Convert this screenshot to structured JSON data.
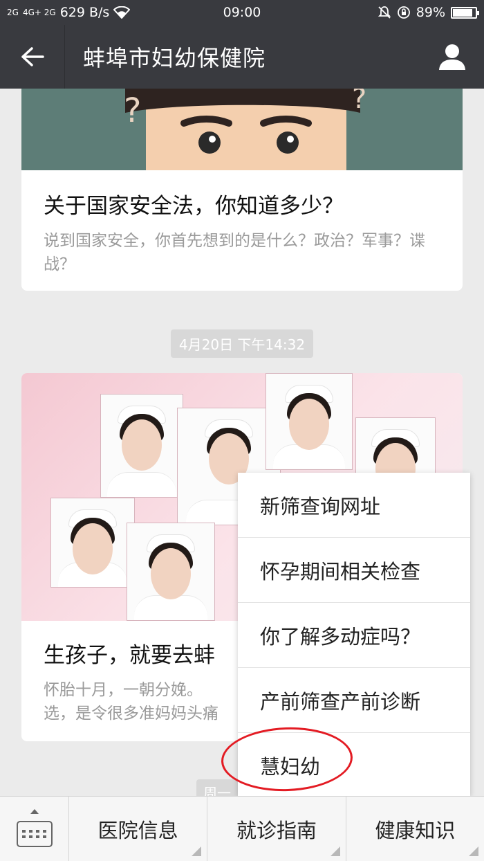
{
  "status_bar": {
    "signal_1": "2G",
    "signal_2": "4G+ 2G",
    "speed": "629 B/s",
    "time": "09:00",
    "battery": "89%",
    "battery_level": 0.89
  },
  "header": {
    "title": "蚌埠市妇幼保健院"
  },
  "feed": {
    "articles": [
      {
        "title": "关于国家安全法，你知道多少？",
        "description": "说到国家安全，你首先想到的是什么？政治？军事？谍战？"
      },
      {
        "title": "生孩子，就要去蚌",
        "description": "怀胎十月，一朝分娩。",
        "description_line2": "选，是令很多准妈妈头痛"
      }
    ],
    "timestamp": "4月20日 下午14:32",
    "next_timestamp": "周一"
  },
  "menu": {
    "items": [
      "新筛查询网址",
      "怀孕期间相关检查",
      "你了解多动症吗？",
      "产前筛查产前诊断",
      "慧妇幼"
    ]
  },
  "bottom_bar": {
    "tabs": [
      "医院信息",
      "就诊指南",
      "健康知识"
    ]
  },
  "colors": {
    "header_bg": "#393a3f",
    "highlight_ring": "#e31b23"
  }
}
